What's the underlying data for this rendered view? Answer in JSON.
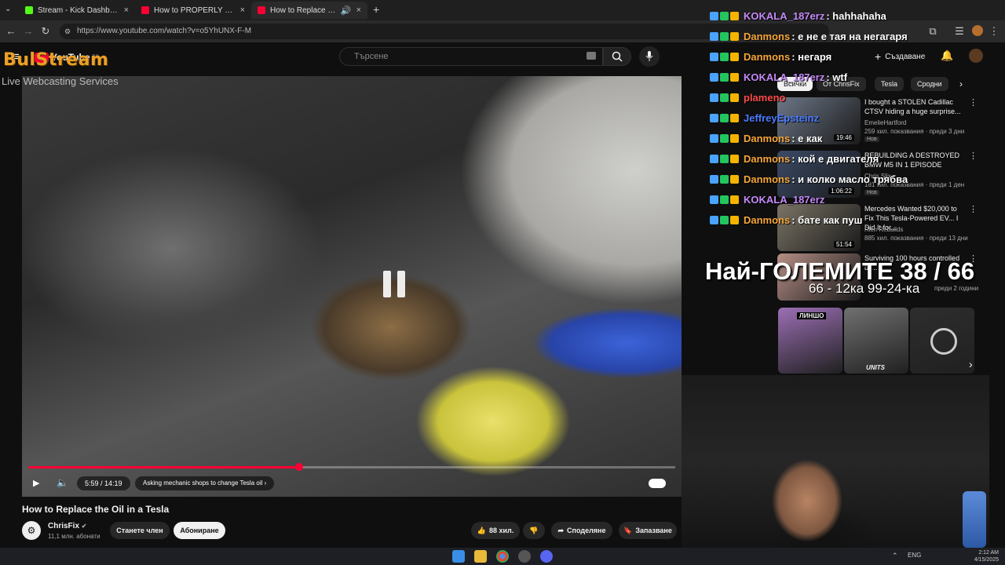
{
  "browser": {
    "tabs": [
      {
        "title": "Stream - Kick Dashboard",
        "favicon_color": "#53fc18",
        "active": false
      },
      {
        "title": "How to PROPERLY Replace a Fo",
        "favicon_color": "#ff0033",
        "active": false
      },
      {
        "title": "How to Replace the Oil in a",
        "favicon_color": "#ff0033",
        "active": true
      }
    ],
    "new_tab": "+",
    "close_glyph": "×",
    "url": "https://www.youtube.com/watch?v=o5YhUNX-F-M"
  },
  "youtube": {
    "logo": "YouTube",
    "logo_country": "BG",
    "search_placeholder": "Търсене",
    "create_label": "Създаване",
    "filter_chips": [
      "Всички",
      "От ChrisFix",
      "Tesla",
      "Сродни"
    ],
    "video": {
      "title": "How to Replace the Oil in a Tesla",
      "time": "5:59 / 14:19",
      "chapter": "Asking mechanic shops to change Tesla oil",
      "progress_fraction": 0.4186,
      "channel": "ChrisFix",
      "subscribers": "11,1 млн. абонати",
      "join_label": "Станете член",
      "subscribe_label": "Абониране",
      "likes": "88 хил.",
      "share_label": "Споделяне",
      "save_label": "Запазване"
    },
    "recommendations": [
      {
        "title": "I bought a STOLEN Cadillac CTSV hiding a huge surprise...",
        "channel": "EmelieHartford",
        "meta": "259 хил. показвания · преди 3 дни",
        "badge": "Нов",
        "duration": "19:46",
        "thumb_color": "#6d7788"
      },
      {
        "title": "REBUILDING A DESTROYED BMW M5 IN 1 EPISODE",
        "channel": "Chris Slix",
        "meta": "181 хил. показвания · преди 1 ден",
        "badge": "Нов",
        "duration": "1:06:22",
        "thumb_color": "#3b4a66"
      },
      {
        "title": "Mercedes Wanted $20,000 to Fix This Tesla-Powered EV... I Did It for...",
        "channel": "Rich Rebuilds",
        "meta": "885 хил. показвания · преди 13 дни",
        "badge": "",
        "duration": "51:54",
        "thumb_color": "#7b7466"
      },
      {
        "title": "Surviving 100 hours controlled by...",
        "channel": "",
        "meta": "преди 2 години",
        "badge": "",
        "duration": "",
        "thumb_color": "#b58f86"
      }
    ],
    "shorts": [
      {
        "label": "ЛИНШО",
        "color": "#9c6fb5"
      },
      {
        "label": "UNITS",
        "color": "#707070"
      },
      {
        "label": "",
        "color": "#2e2e2e"
      }
    ]
  },
  "overlay": {
    "logo": "BulStream",
    "subtitle": "Live Webcasting Services",
    "chat": [
      {
        "user": "KOKALA_187erz",
        "msg": "hahhahaha",
        "color": "#c58af9"
      },
      {
        "user": "Danmons",
        "msg": "е не е тая на негагаря",
        "color": "#f6a63a"
      },
      {
        "user": "Danmons",
        "msg": "негаря",
        "color": "#f6a63a"
      },
      {
        "user": "KOKALA_187erz",
        "msg": "wtf",
        "color": "#c58af9"
      },
      {
        "user": "plameno",
        "msg": "",
        "color": "#ff4b4b"
      },
      {
        "user": "JeffreyEpsteinz",
        "msg": "",
        "color": "#4b7bff"
      },
      {
        "user": "Danmons",
        "msg": "е как",
        "color": "#f6a63a"
      },
      {
        "user": "Danmons",
        "msg": "кой е двигателя",
        "color": "#f6a63a"
      },
      {
        "user": "Danmons",
        "msg": "и колко масло трябва",
        "color": "#f6a63a"
      },
      {
        "user": "KOKALA_187erz",
        "msg": "",
        "color": "#c58af9"
      },
      {
        "user": "Danmons",
        "msg": "бате как пуш",
        "color": "#f6a63a"
      }
    ],
    "big_text": "Най-ГОЛЕМИТЕ 38 / 66",
    "sub_text": "66 - 12ка 99-24-ка"
  },
  "taskbar": {
    "lang": "ENG",
    "time": "2:12 AM",
    "date": "4/15/2025"
  }
}
